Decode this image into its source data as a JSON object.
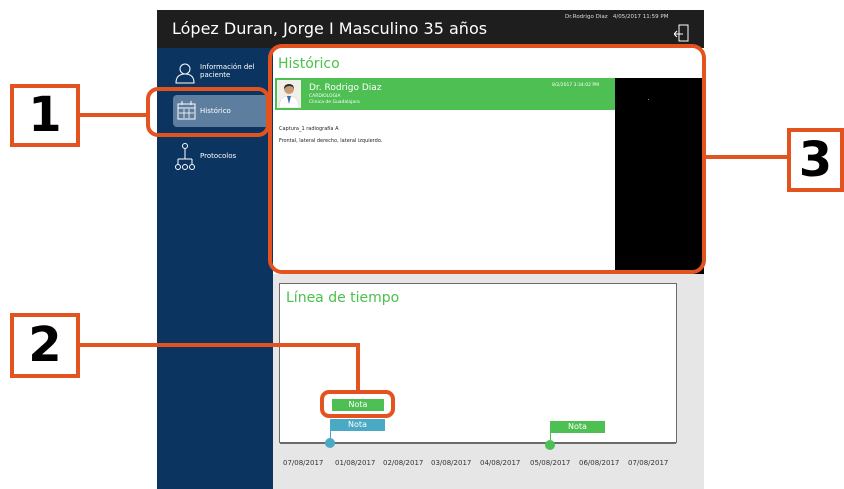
{
  "header": {
    "patient": "López  Duran, Jorge I Masculino 35 años",
    "doctor": "Dr.Rodrigo Diaz",
    "datetime": "4/05/2017 11:59 PM"
  },
  "sidebar": {
    "items": [
      {
        "label": "Información del paciente",
        "icon": "person-icon"
      },
      {
        "label": "Histórico",
        "icon": "calendar-icon",
        "active": true
      },
      {
        "label": "Protocolos",
        "icon": "tree-icon"
      }
    ]
  },
  "historico": {
    "title": "Histórico",
    "entry": {
      "doctor": "Dr. Rodrigo Diaz",
      "specialty": "CARDIOLOGIA",
      "clinic": "Clinica de Guadalajara",
      "date": "8/2/2017 3:34:02 PM",
      "line1": "Captura_1 radiografía A",
      "line2": "Frontal, lateral derecho, lateral izquierdo."
    }
  },
  "timeline": {
    "title": "Línea de tiempo",
    "notes": [
      "Nota",
      "Nota",
      "Nota"
    ],
    "dates": [
      "07/08/2017",
      "01/08/2017",
      "02/08/2017",
      "03/08/2017",
      "04/08/2017",
      "05/08/2017",
      "06/08/2017",
      "07/08/2017"
    ]
  },
  "callouts": [
    "1",
    "2",
    "3"
  ],
  "colors": {
    "accent_green": "#4dbf53",
    "sidebar": "#0c3460",
    "callout": "#e3531f",
    "teal": "#4aa9c4"
  }
}
